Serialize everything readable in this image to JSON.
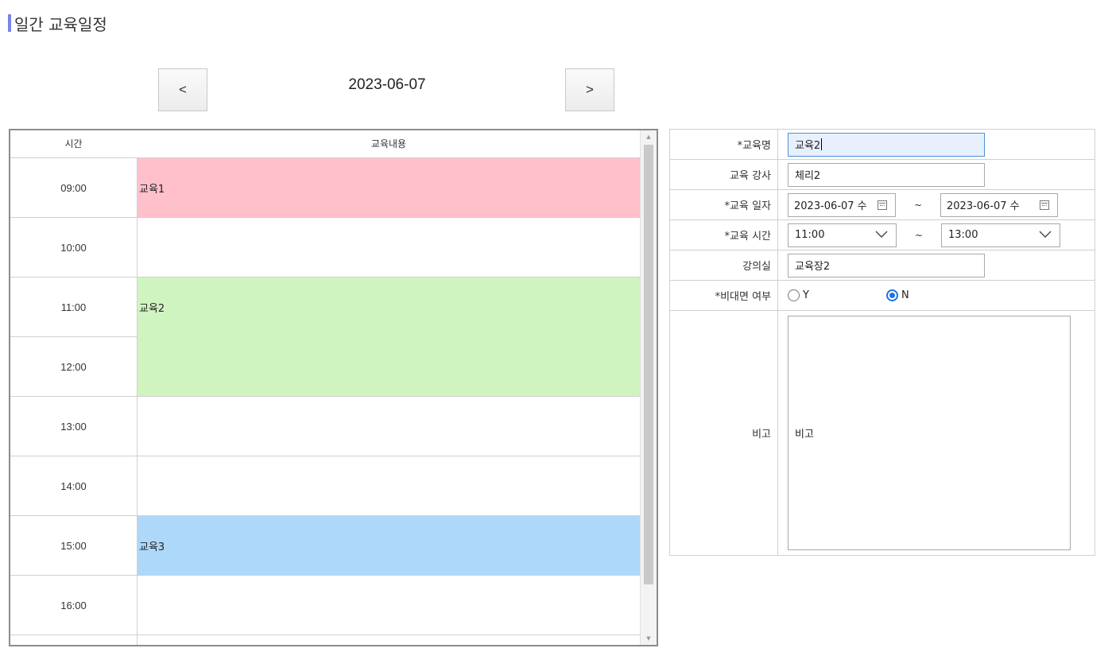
{
  "page": {
    "title": "일간 교육일정"
  },
  "nav": {
    "prev_label": "<",
    "next_label": ">",
    "current_date": "2023-06-07"
  },
  "schedule": {
    "header_time": "시간",
    "header_content": "교육내용",
    "times": [
      "09:00",
      "10:00",
      "11:00",
      "12:00",
      "13:00",
      "14:00",
      "15:00",
      "16:00"
    ],
    "events": [
      {
        "title": "교육1",
        "start": "09:00",
        "end": "10:00",
        "color": "#ffc0cb"
      },
      {
        "title": "교육2",
        "start": "11:00",
        "end": "13:00",
        "color": "#d0f4c0"
      },
      {
        "title": "교육3",
        "start": "15:00",
        "end": "16:00",
        "color": "#add8fa"
      }
    ]
  },
  "form": {
    "name_label": "*교육명",
    "name_value": "교육2",
    "instructor_label": "교육 강사",
    "instructor_value": "체리2",
    "date_label": "*교육 일자",
    "date_from": "2023-06-07 수",
    "date_to": "2023-06-07 수",
    "tilde": "~",
    "time_label": "*교육 시간",
    "time_from": "11:00",
    "time_to": "13:00",
    "room_label": "강의실",
    "room_value": "교육장2",
    "online_label": "*비대면 여부",
    "online_yes": "Y",
    "online_no": "N",
    "online_selected": "N",
    "remark_label": "비고",
    "remark_value": "비고"
  },
  "colors": {
    "accent": "#7b83eb",
    "radio_selected": "#1a73e8"
  }
}
